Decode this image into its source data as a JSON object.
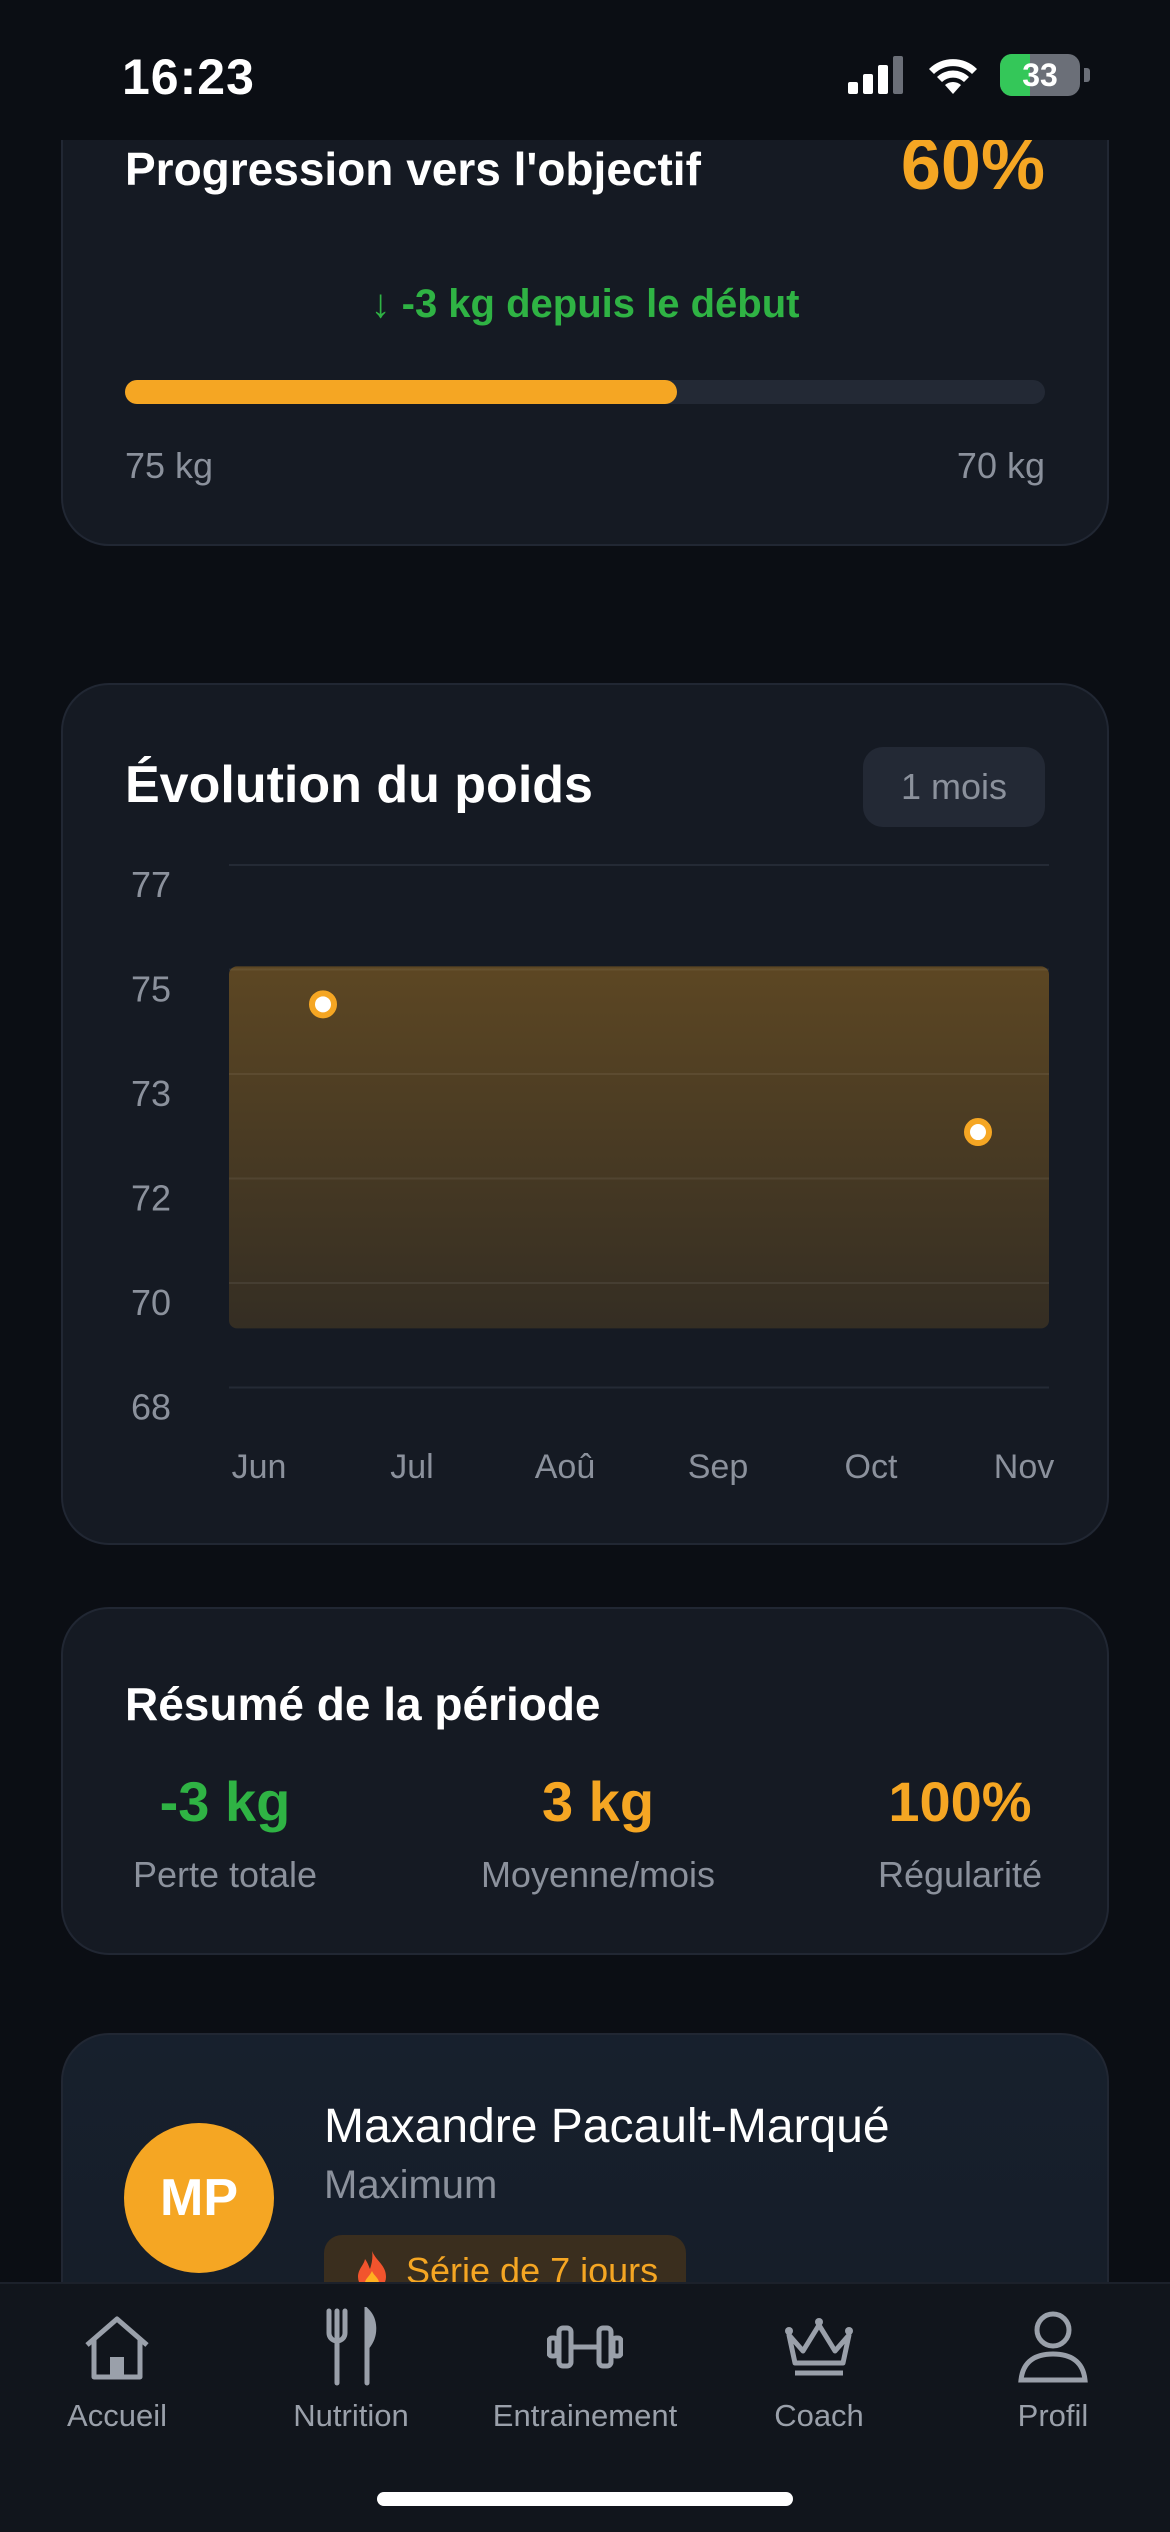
{
  "status_bar": {
    "time": "16:23",
    "battery": "33"
  },
  "progress": {
    "title": "Progression vers l'objectif",
    "percent_label": "60%",
    "percent_value": 0.6,
    "delta": "↓ -3 kg depuis le début",
    "start_label": "75 kg",
    "goal_label": "70 kg"
  },
  "chart_card": {
    "title": "Évolution du poids",
    "period": "1 mois"
  },
  "chart_data": {
    "type": "scatter",
    "title": "Évolution du poids",
    "x": [
      "Jun",
      "Nov"
    ],
    "y": [
      74.6,
      72.4
    ],
    "categories": [
      "Jun",
      "Jul",
      "Aoû",
      "Sep",
      "Oct",
      "Nov"
    ],
    "ytick_labels": [
      "77",
      "75",
      "73",
      "72",
      "70",
      "68"
    ],
    "ylim": [
      68,
      77
    ],
    "grid": true,
    "accent": "#f5a623"
  },
  "summary": {
    "title": "Résumé de la période",
    "stats": [
      {
        "value": "-3 kg",
        "label": "Perte totale",
        "color": "#2fb344"
      },
      {
        "value": "3 kg",
        "label": "Moyenne/mois",
        "color": "#f5a623"
      },
      {
        "value": "100%",
        "label": "Régularité",
        "color": "#f5a623"
      }
    ]
  },
  "profile": {
    "initials": "MP",
    "name": "Maxandre Pacault-Marqué",
    "subtitle": "Maximum",
    "streak": "Série de 7 jours",
    "streak_icon": "fire-icon"
  },
  "tabs": [
    {
      "label": "Accueil",
      "icon": "home-icon"
    },
    {
      "label": "Nutrition",
      "icon": "fork-knife-icon"
    },
    {
      "label": "Entrainement",
      "icon": "dumbbell-icon"
    },
    {
      "label": "Coach",
      "icon": "crown-icon"
    },
    {
      "label": "Profil",
      "icon": "person-icon"
    }
  ]
}
